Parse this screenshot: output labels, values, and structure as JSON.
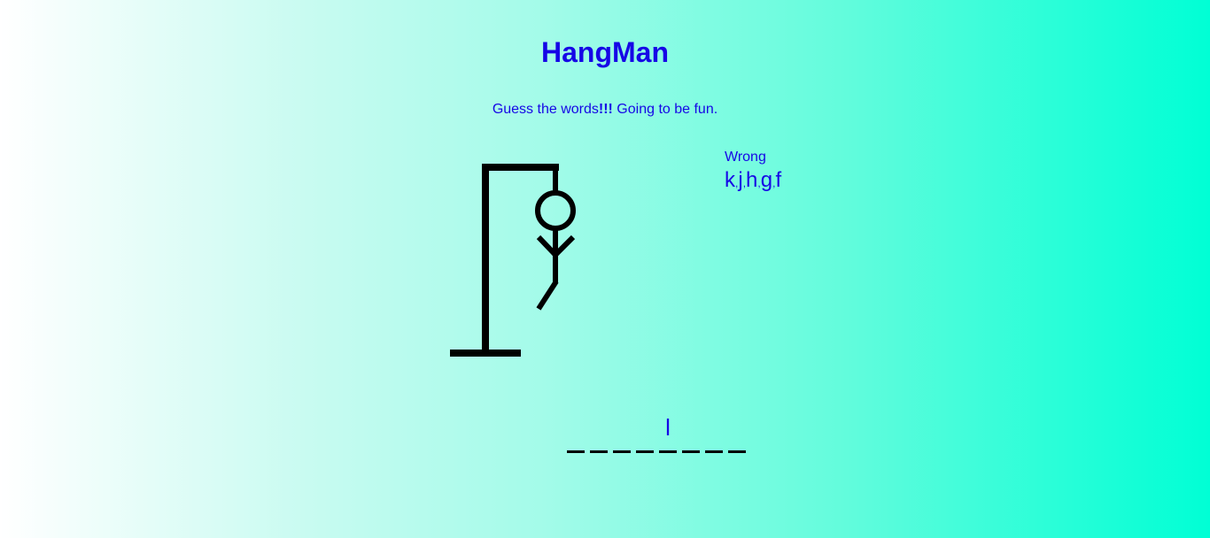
{
  "header": {
    "title": "HangMan",
    "subtitle_prefix": "Guess the words",
    "subtitle_bold": "!!!",
    "subtitle_suffix": " Going to be fun."
  },
  "wrong": {
    "label": "Wrong",
    "letters": [
      "k",
      "j",
      "h",
      "g",
      "f"
    ]
  },
  "word": {
    "slots": [
      "",
      "",
      "",
      "",
      "l",
      "",
      "",
      ""
    ]
  },
  "game": {
    "wrong_count": 5,
    "body_parts_drawn": [
      "head",
      "body",
      "left-arm",
      "right-arm",
      "left-leg"
    ]
  },
  "colors": {
    "text": "#1606e6",
    "drawing": "#000000"
  }
}
